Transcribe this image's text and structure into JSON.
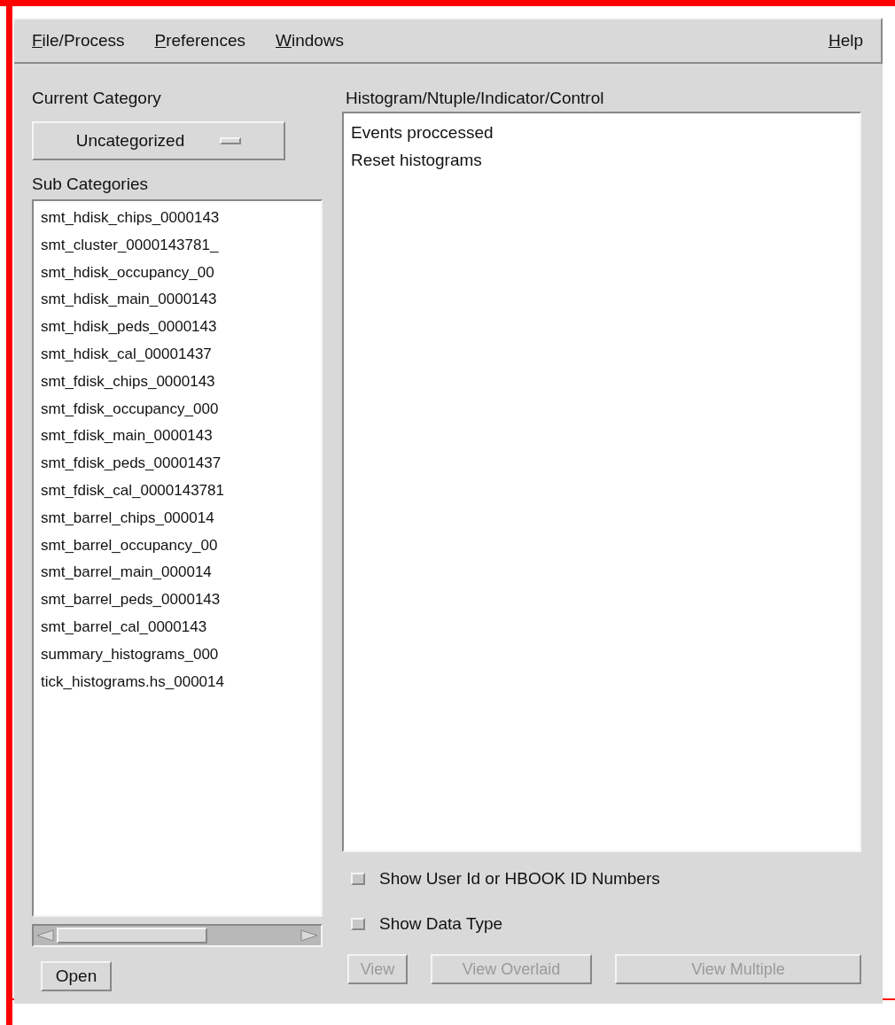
{
  "menu_bar": {
    "items": [
      {
        "label": "File/Process"
      },
      {
        "label": "Preferences"
      },
      {
        "label": "Windows"
      },
      {
        "label": "Help"
      }
    ]
  },
  "current_category": {
    "label": "Current Category",
    "value": "Uncategorized"
  },
  "sub_categories": {
    "label": "Sub Categories",
    "items": [
      "smt_hdisk_chips_0000143",
      "smt_cluster_0000143781_",
      "smt_hdisk_occupancy_00",
      "smt_hdisk_main_0000143",
      "smt_hdisk_peds_0000143",
      "smt_hdisk_cal_00001437",
      "smt_fdisk_chips_0000143",
      "smt_fdisk_occupancy_000",
      "smt_fdisk_main_0000143",
      "smt_fdisk_peds_00001437",
      "smt_fdisk_cal_0000143781",
      "smt_barrel_chips_000014",
      "smt_barrel_occupancy_00",
      "smt_barrel_main_000014",
      "smt_barrel_peds_0000143",
      "smt_barrel_cal_0000143",
      "summary_histograms_000",
      "tick_histograms.hs_000014"
    ]
  },
  "open_button": {
    "label": "Open"
  },
  "histograms": {
    "label": "Histogram/Ntuple/Indicator/Control",
    "items": [
      "Events proccessed",
      "Reset histograms"
    ]
  },
  "options": [
    {
      "label": "Show User Id or HBOOK ID Numbers",
      "checked": false
    },
    {
      "label": "Show Data Type",
      "checked": false
    }
  ],
  "buttons": [
    {
      "label": "View",
      "disabled": true
    },
    {
      "label": "View Overlaid",
      "disabled": true
    },
    {
      "label": "View Multiple",
      "disabled": true
    }
  ]
}
